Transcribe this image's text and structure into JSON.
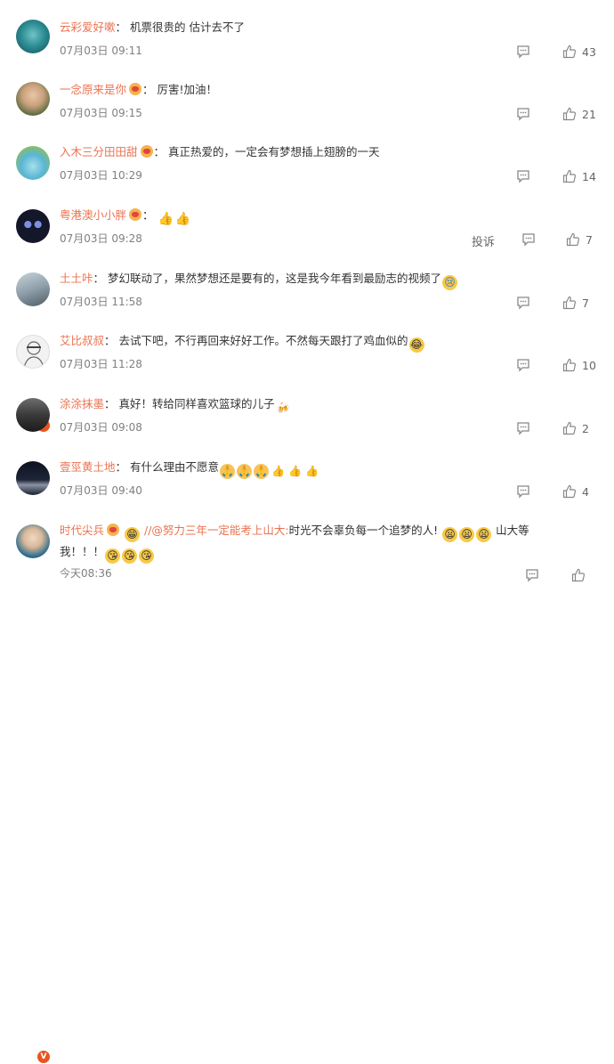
{
  "colors": {
    "accent": "#eb7350",
    "time": "#808080",
    "badge": "#e8541e"
  },
  "comments": [
    {
      "author": "云彩爱好嗽",
      "sep": "：",
      "text": "机票很贵的 估计去不了",
      "time": "07月03日 09:11",
      "likes": "43"
    },
    {
      "author": "一念原来是你",
      "sep": "：",
      "text": "厉害!加油！",
      "time": "07月03日 09:15",
      "likes": "21"
    },
    {
      "author": "入木三分田田甜",
      "sep": "：",
      "text": "真正热爱的，一定会有梦想插上翅膀的一天",
      "time": "07月03日 10:29",
      "likes": "14"
    },
    {
      "author": "粤港澳小小胖",
      "sep": "：",
      "text": "",
      "time": "07月03日 09:28",
      "likes": "7",
      "report": "投诉"
    },
    {
      "author": "土土咔",
      "sep": "：",
      "text": "梦幻联动了，果然梦想还是要有的，这是我今年看到最励志的视频了",
      "time": "07月03日 11:58",
      "likes": "7"
    },
    {
      "author": "艾比叔叔",
      "sep": "：",
      "text": "去试下吧，不行再回来好好工作。不然每天跟打了鸡血似的",
      "time": "07月03日 11:28",
      "likes": "10"
    },
    {
      "author": "涂涂抹墨",
      "sep": "：",
      "text": "真好！转给同样喜欢篮球的儿子",
      "time": "07月03日 09:08",
      "likes": "2"
    },
    {
      "author": "壹巠黄土地",
      "sep": "：",
      "text": "有什么理由不愿意",
      "time": "07月03日 09:40",
      "likes": "4"
    },
    {
      "author": "时代尖兵",
      "sep": "",
      "mention": "//@努力三年一定能考上山大:",
      "text": "时光不会辜负每一个追梦的人!",
      "text_tail": "山大等",
      "text_line2": "我！！！",
      "time": "今天08:36",
      "likes": ""
    }
  ]
}
